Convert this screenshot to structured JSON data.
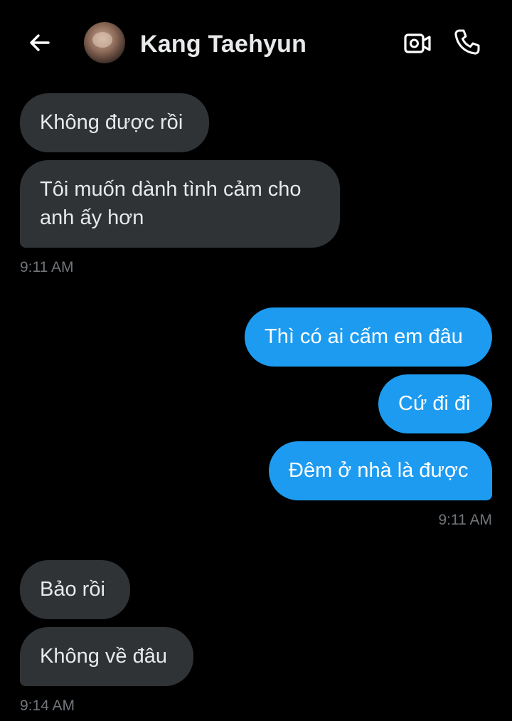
{
  "header": {
    "title": "Kang Taehyun",
    "back_icon": "arrow-left-icon",
    "video_icon": "video-call-icon",
    "call_icon": "phone-icon"
  },
  "messages": [
    {
      "direction": "in",
      "text": "Không được rồi"
    },
    {
      "direction": "in",
      "lines": [
        "Tôi muốn dành tình cảm cho",
        "anh ấy hơn"
      ]
    },
    {
      "direction": "out",
      "text": "Thì có ai cấm em đâu"
    },
    {
      "direction": "out",
      "text": "Cứ đi đi"
    },
    {
      "direction": "out",
      "text": "Đêm ở nhà là được"
    },
    {
      "direction": "in",
      "text": "Bảo rồi"
    },
    {
      "direction": "in",
      "text": "Không về đâu"
    }
  ],
  "timestamps": [
    "9:11 AM",
    "9:11 AM",
    "9:14 AM"
  ],
  "colors": {
    "background": "#000000",
    "incoming_bubble": "#2f3336",
    "outgoing_bubble": "#1d9bf0",
    "timestamp": "#71767b"
  }
}
